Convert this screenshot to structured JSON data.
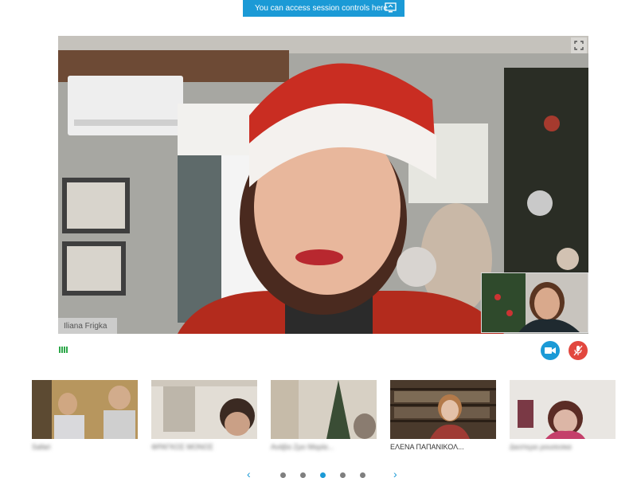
{
  "banner": {
    "text": "You can access session controls here",
    "icon": "screen-share-icon"
  },
  "main_video": {
    "speaker_name": "Iliana Frigka",
    "expand_icon": "expand-icon"
  },
  "controls": {
    "video_icon": "video-camera-icon",
    "mic_icon": "mic-muted-icon",
    "signal_icon": "signal-strength-icon"
  },
  "thumbnails": [
    {
      "label": "Safari",
      "blurred": true
    },
    {
      "label": "ΦΡΑΓΚΟΣ ΜΟΝΟΣ",
      "blurred": true
    },
    {
      "label": "Ανάβα Ζρο Μαρία...",
      "blurred": true
    },
    {
      "label": "ΕΛΕΝΑ ΠΑΠΑΝΙΚΟΛ...",
      "blurred": false
    },
    {
      "label": "Διεστερα ρουσεσκα",
      "blurred": true
    }
  ],
  "pager": {
    "total": 5,
    "active": 3,
    "prev_icon": "chevron-left-icon",
    "next_icon": "chevron-right-icon"
  },
  "colors": {
    "accent": "#1b9ad6",
    "mic_off": "#e2473e",
    "signal": "#2ea84a"
  }
}
